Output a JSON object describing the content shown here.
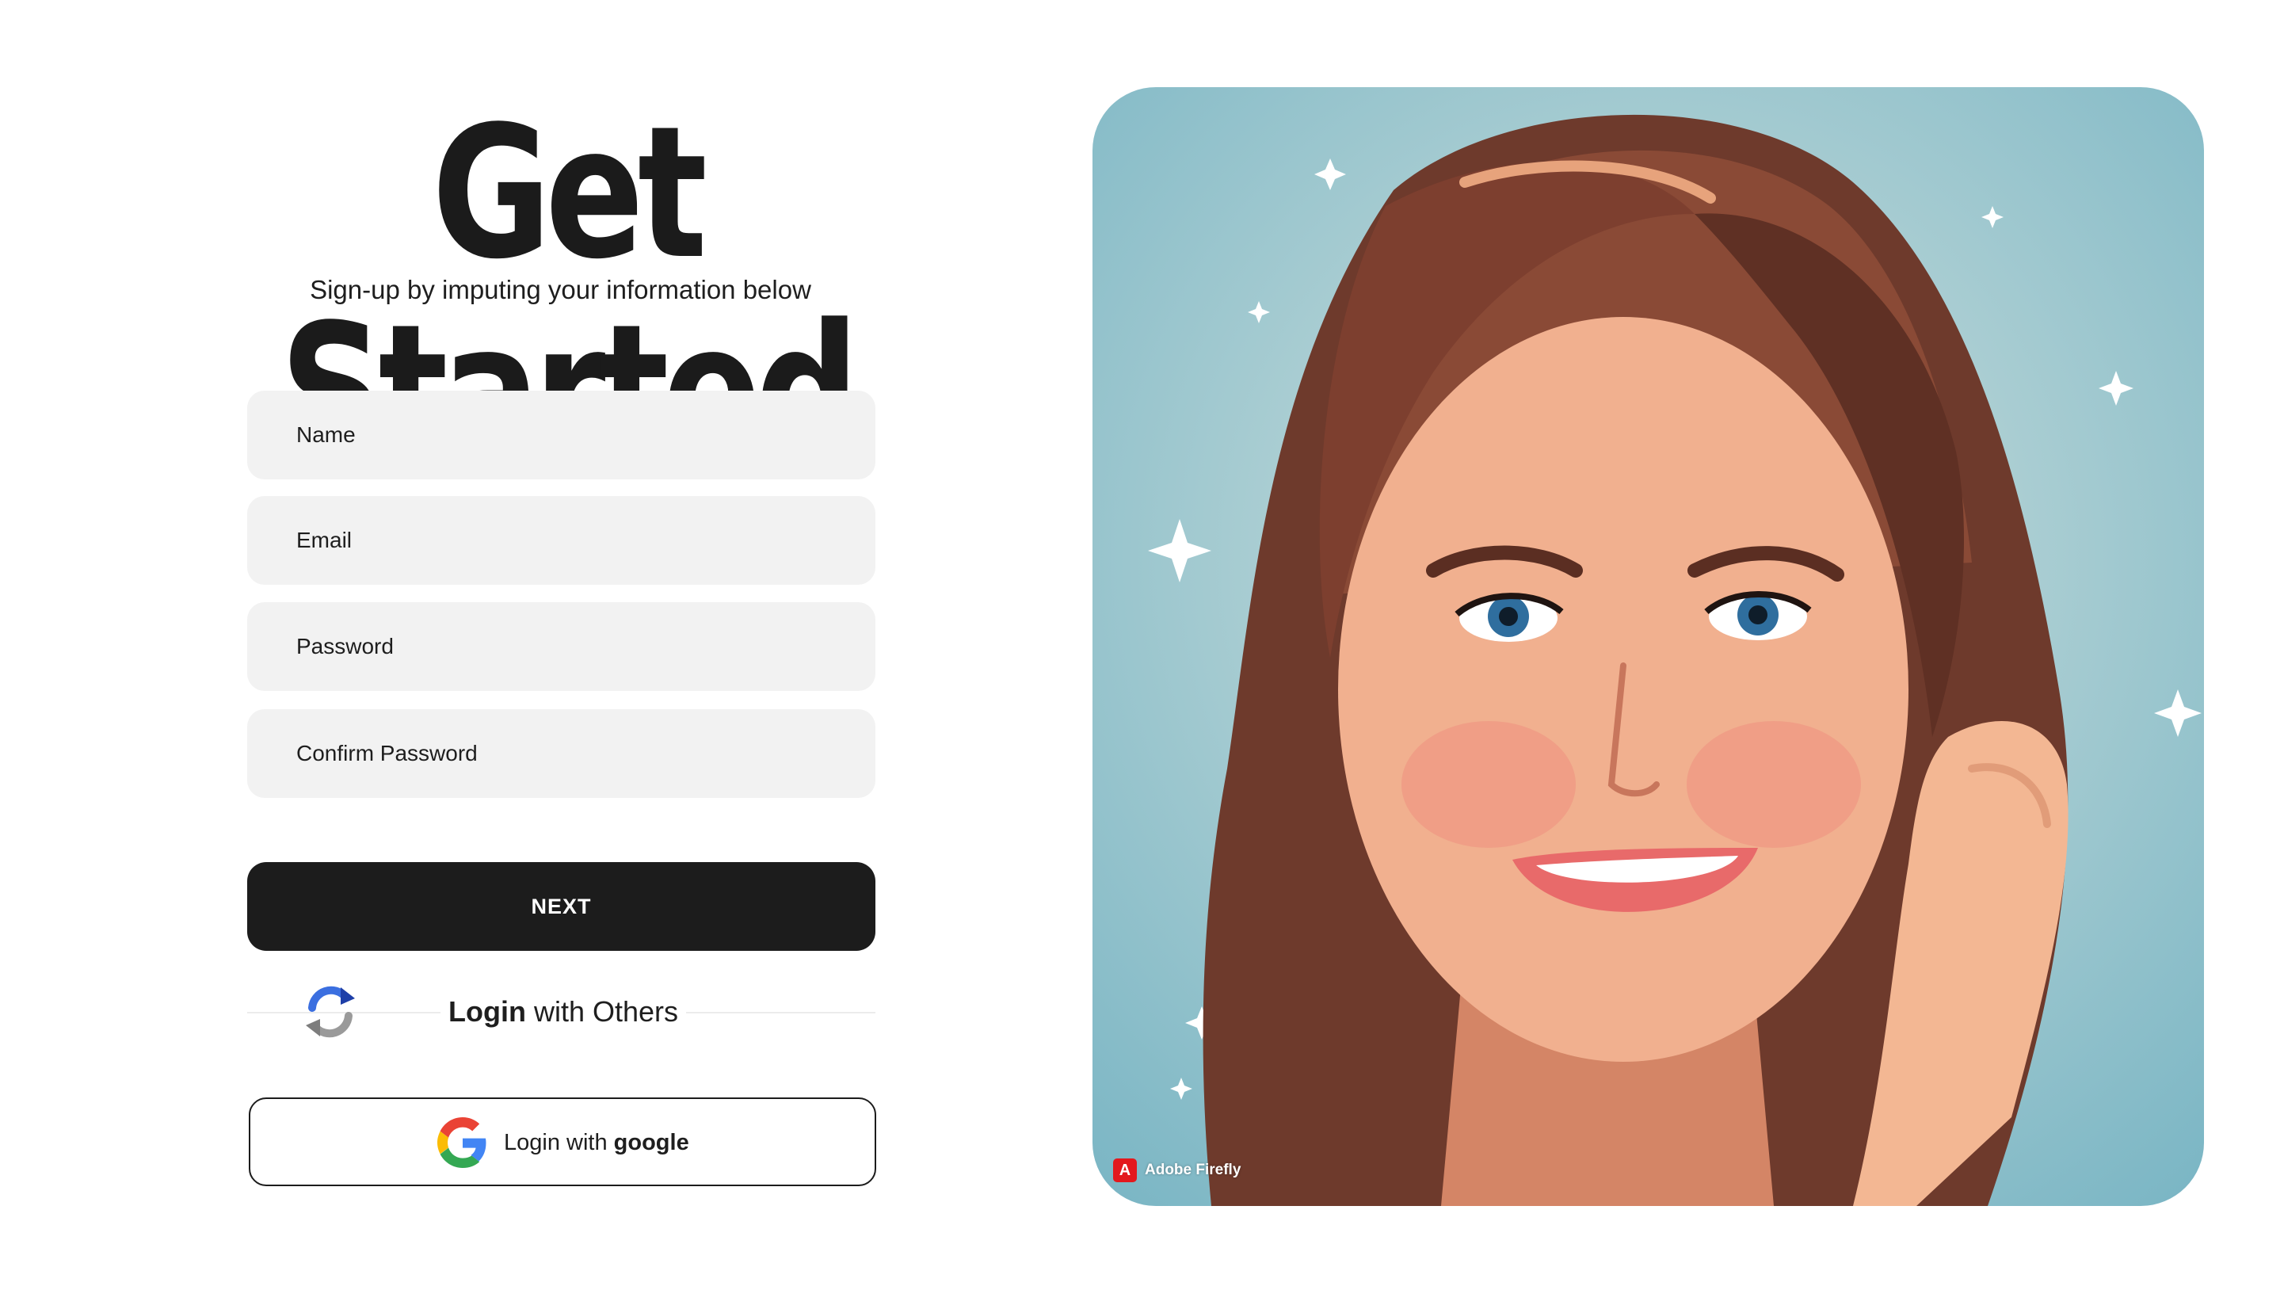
{
  "header": {
    "title": "Get Started",
    "subtitle": "Sign-up by imputing your information below"
  },
  "form": {
    "fields": [
      {
        "placeholder": "Name"
      },
      {
        "placeholder": "Email"
      },
      {
        "placeholder": "Password"
      },
      {
        "placeholder": "Confirm Password"
      }
    ],
    "next_label": "NEXT"
  },
  "social": {
    "divider_bold": "Login",
    "divider_rest": " with Others",
    "google_prefix": "Login with ",
    "google_bold": "google"
  },
  "hero": {
    "badge_logo": "A",
    "badge_text": "Adobe Firefly"
  },
  "colors": {
    "primary": "#1c1c1c",
    "field_bg": "#f2f2f2",
    "hero_bg": "#79b5c4",
    "badge_red": "#e3181d"
  },
  "icons": [
    "refresh-icon",
    "google-icon",
    "adobe-firefly-logo-icon"
  ]
}
